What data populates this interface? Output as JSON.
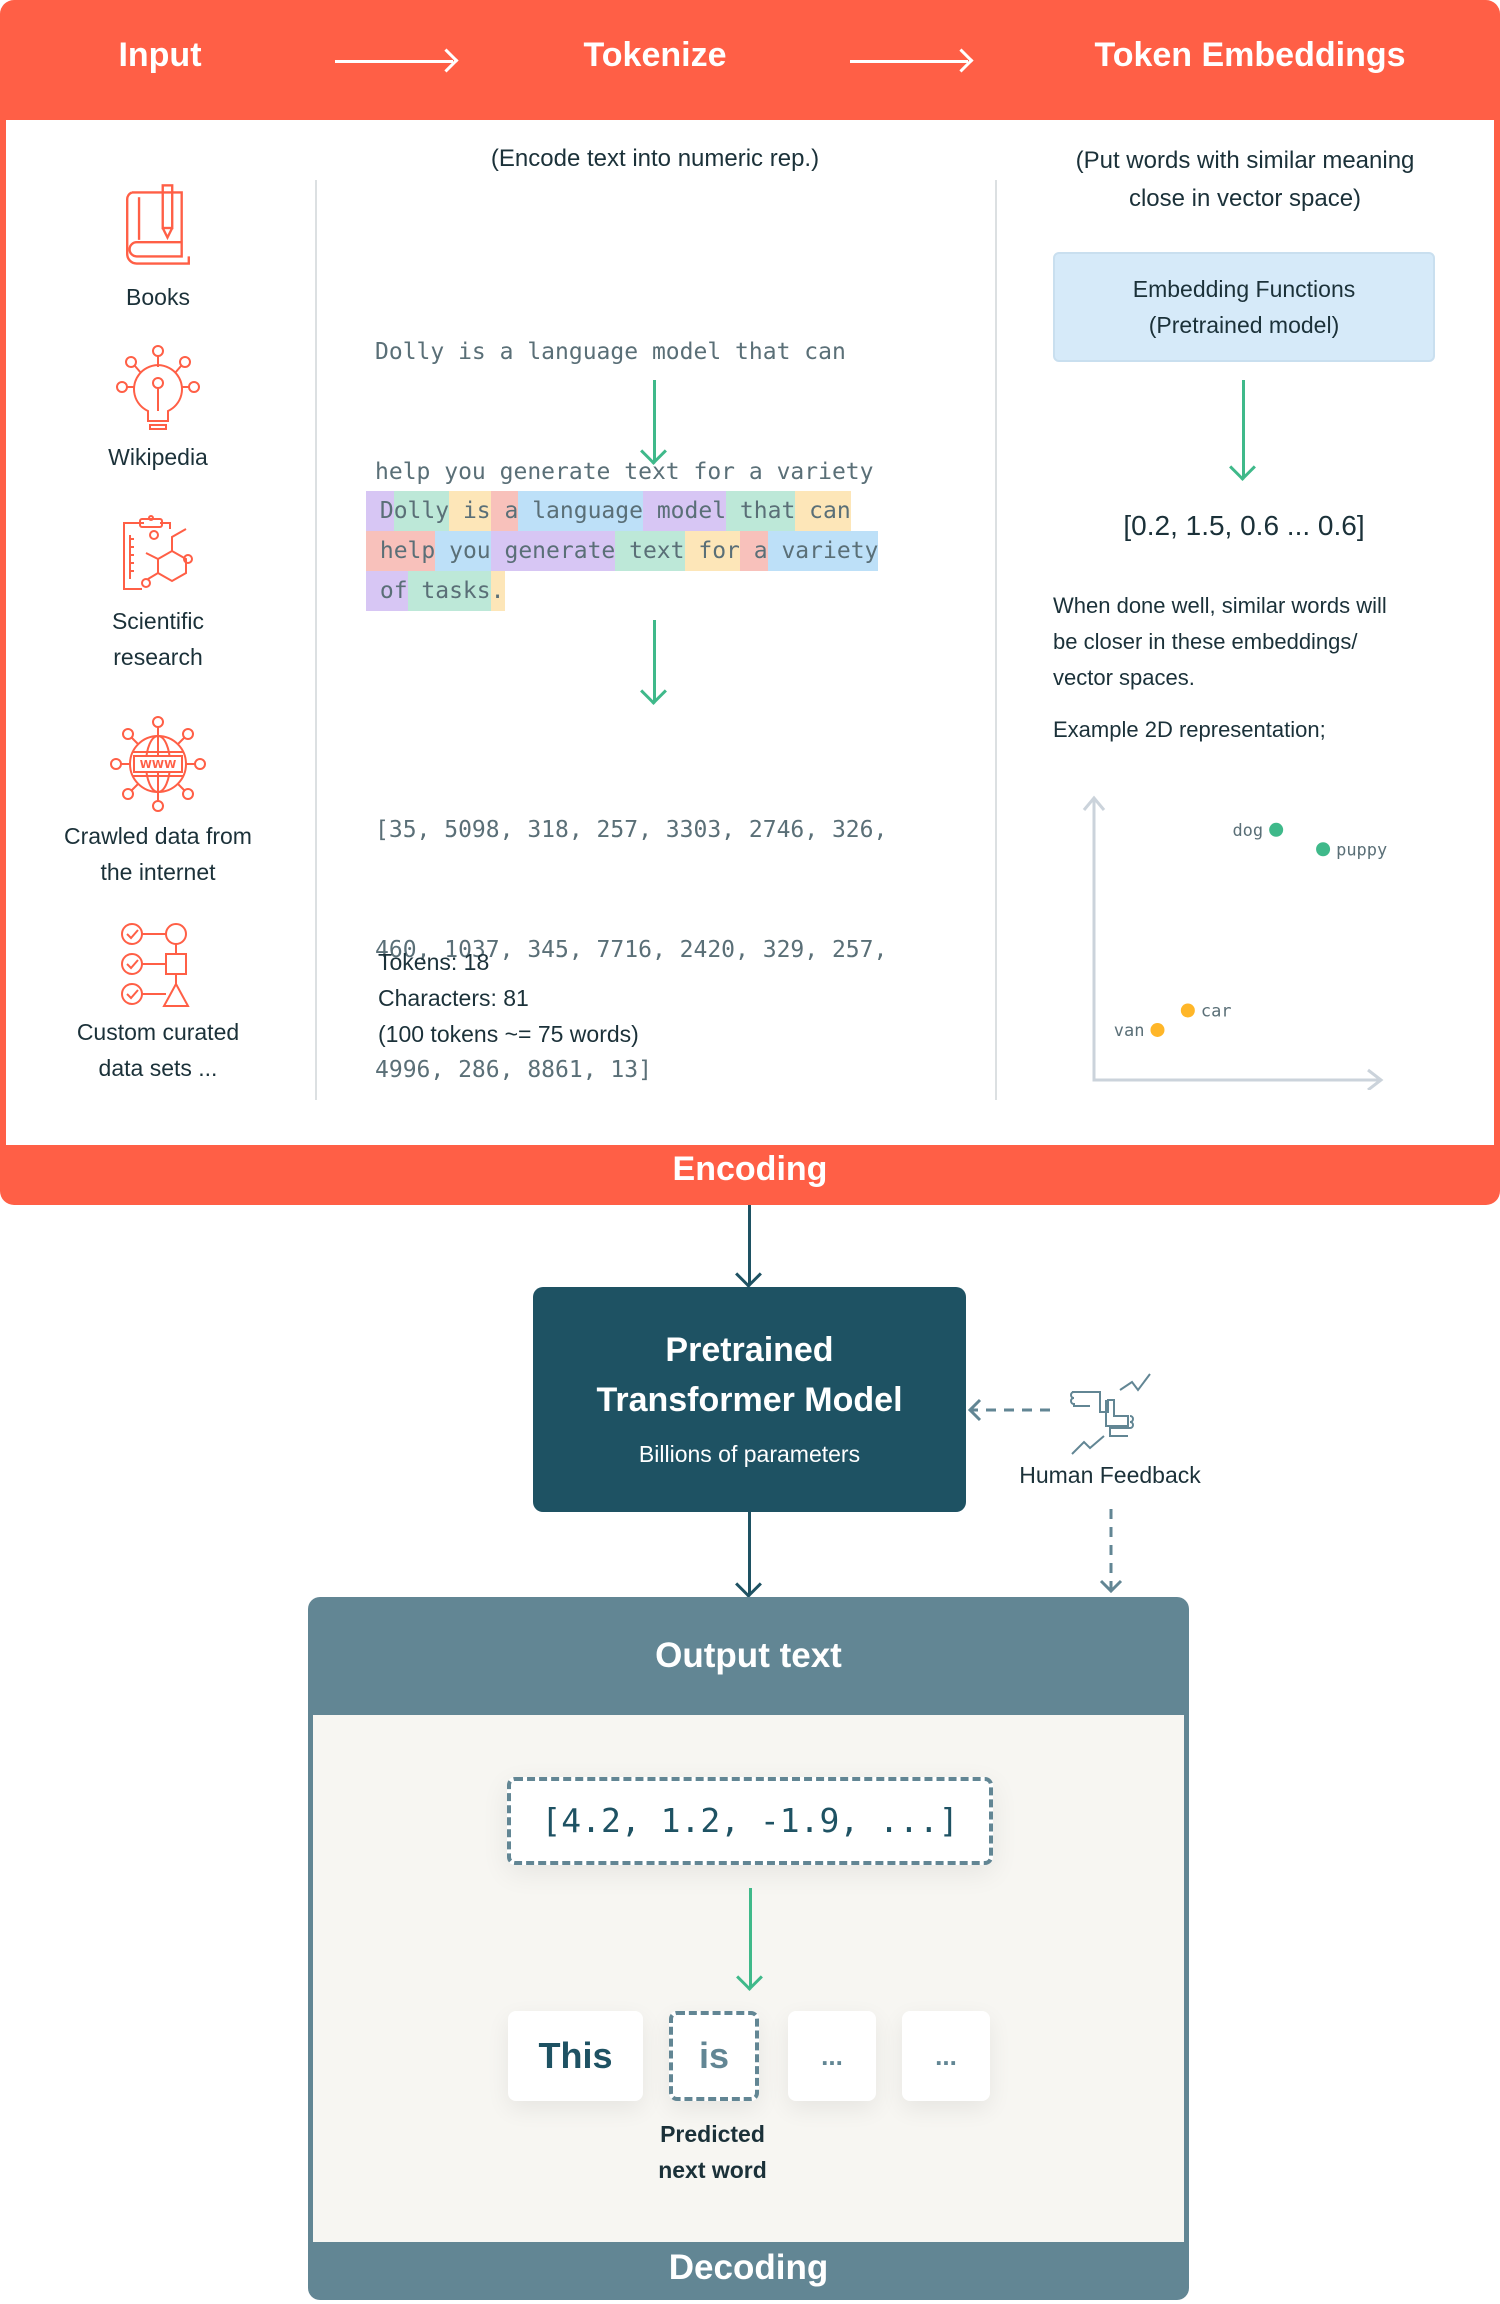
{
  "header": {
    "steps": [
      "Input",
      "Tokenize",
      "Token Embeddings"
    ]
  },
  "input": {
    "sources": [
      {
        "icon": "book-pencil-icon",
        "label": "Books"
      },
      {
        "icon": "lightbulb-network-icon",
        "label": "Wikipedia"
      },
      {
        "icon": "clipboard-molecule-icon",
        "label": "Scientific research"
      },
      {
        "icon": "globe-www-icon",
        "label": "Crawled data from the internet"
      },
      {
        "icon": "checklist-shapes-icon",
        "label": "Custom curated data sets ..."
      }
    ]
  },
  "tokenize": {
    "subtitle": "(Encode text into numeric rep.)",
    "raw_text_lines": [
      "Dolly is a language model that can",
      "help you generate text for a variety",
      "of tasks."
    ],
    "token_lines": [
      [
        {
          "t": "D",
          "c": "purple"
        },
        {
          "t": "olly",
          "c": "green"
        },
        {
          "t": " is",
          "c": "yellow"
        },
        {
          "t": " a",
          "c": "red"
        },
        {
          "t": " language",
          "c": "blue"
        },
        {
          "t": " model",
          "c": "purple"
        },
        {
          "t": " that",
          "c": "green"
        },
        {
          "t": " can",
          "c": "yellow"
        }
      ],
      [
        {
          "t": "help",
          "c": "red"
        },
        {
          "t": " you",
          "c": "blue"
        },
        {
          "t": " generate",
          "c": "purple"
        },
        {
          "t": " text",
          "c": "green"
        },
        {
          "t": " for",
          "c": "yellow"
        },
        {
          "t": " a",
          "c": "red"
        },
        {
          "t": " variety",
          "c": "blue"
        }
      ],
      [
        {
          "t": "of",
          "c": "purple"
        },
        {
          "t": " tasks",
          "c": "green"
        },
        {
          "t": ".",
          "c": "yellow"
        }
      ]
    ],
    "ids_lines": [
      "[35, 5098, 318, 257, 3303, 2746, 326,",
      "460, 1037, 345, 7716, 2420, 329, 257,",
      "4996, 286, 8861, 13]"
    ],
    "stats": [
      "Tokens: 18",
      "Characters: 81",
      "(100 tokens ~= 75 words)"
    ]
  },
  "embeddings": {
    "subtitle_lines": [
      "(Put words with similar meaning",
      "close in vector space)"
    ],
    "box_lines": [
      "Embedding Functions",
      "(Pretrained model)"
    ],
    "vector": "[0.2, 1.5, 0.6 ... 0.6]",
    "description_lines": [
      "When done well, similar words will",
      "be closer in these embeddings/",
      "vector spaces."
    ],
    "example_label": "Example 2D representation;"
  },
  "chart_data": {
    "type": "scatter",
    "title": "",
    "xlabel": "",
    "ylabel": "",
    "xlim": [
      0,
      10
    ],
    "ylim": [
      0,
      10
    ],
    "grid": false,
    "points": [
      {
        "label": "dog",
        "x": 6.6,
        "y": 9.0,
        "color": "#3fb98a",
        "label_side": "left"
      },
      {
        "label": "puppy",
        "x": 8.3,
        "y": 8.3,
        "color": "#3fb98a",
        "label_side": "right"
      },
      {
        "label": "car",
        "x": 3.4,
        "y": 2.5,
        "color": "#ffb628",
        "label_side": "right"
      },
      {
        "label": "van",
        "x": 2.3,
        "y": 1.8,
        "color": "#ffb628",
        "label_side": "left"
      }
    ]
  },
  "encoding_label": "Encoding",
  "model": {
    "title_lines": [
      "Pretrained",
      "Transformer Model"
    ],
    "subtitle": "Billions of parameters"
  },
  "human_feedback": {
    "icon": "thumbs-feedback-icon",
    "label": "Human Feedback"
  },
  "output": {
    "title": "Output text",
    "vector": "[4.2, 1.2, -1.9, ...]",
    "words": [
      "This",
      "is",
      "...",
      "..."
    ],
    "predicted_label_lines": [
      "Predicted",
      "next word"
    ],
    "decoding_label": "Decoding"
  },
  "colors": {
    "brand_orange": "#ff5f46",
    "dark_teal": "#1e5263",
    "slate": "#628694",
    "green": "#3fb98a",
    "yellow": "#ffb628"
  }
}
